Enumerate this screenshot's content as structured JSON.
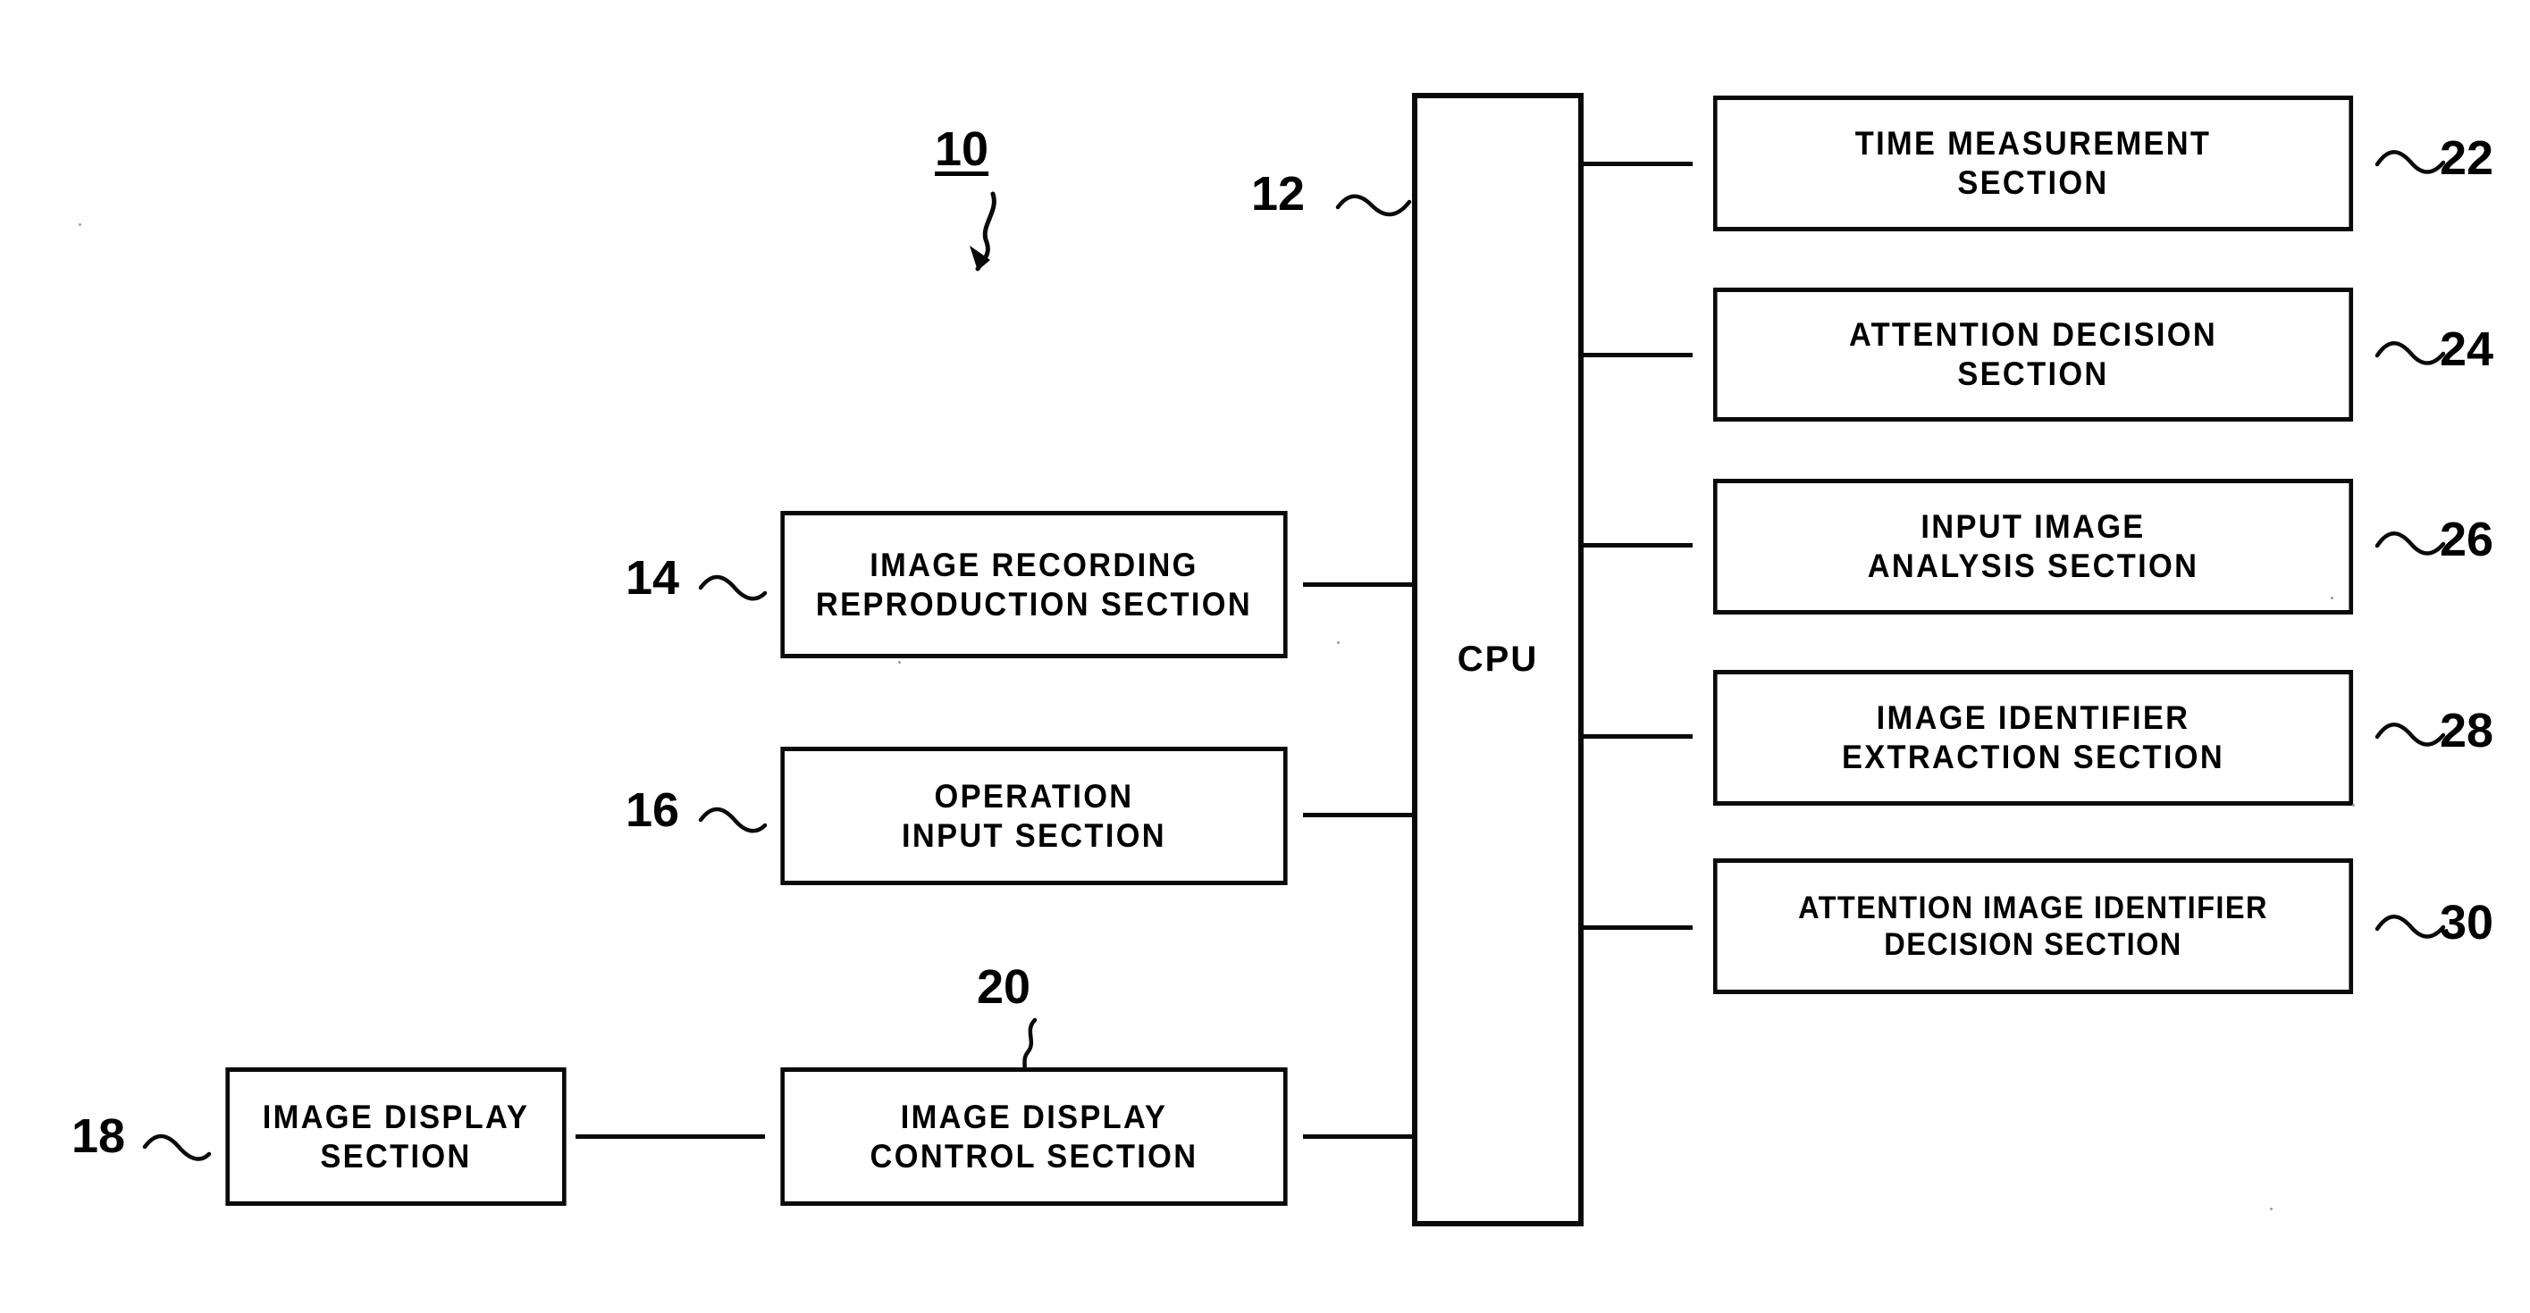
{
  "figure": {
    "system_label": "10",
    "cpu_label": "CPU",
    "cpu_ref": "12"
  },
  "left_blocks": [
    {
      "ref": "14",
      "lines": [
        "IMAGE RECORDING",
        "REPRODUCTION SECTION"
      ]
    },
    {
      "ref": "16",
      "lines": [
        "OPERATION",
        "INPUT SECTION"
      ]
    },
    {
      "ref": "18",
      "lines": [
        "IMAGE DISPLAY",
        "SECTION"
      ]
    },
    {
      "ref": "20",
      "lines": [
        "IMAGE DISPLAY",
        "CONTROL SECTION"
      ]
    }
  ],
  "right_blocks": [
    {
      "ref": "22",
      "lines": [
        "TIME MEASUREMENT",
        "SECTION"
      ]
    },
    {
      "ref": "24",
      "lines": [
        "ATTENTION DECISION",
        "SECTION"
      ]
    },
    {
      "ref": "26",
      "lines": [
        "INPUT IMAGE",
        "ANALYSIS SECTION"
      ]
    },
    {
      "ref": "28",
      "lines": [
        "IMAGE IDENTIFIER",
        "EXTRACTION SECTION"
      ]
    },
    {
      "ref": "30",
      "lines": [
        "ATTENTION IMAGE IDENTIFIER",
        "DECISION SECTION"
      ]
    }
  ],
  "colors": {
    "ink": "#0a0a0a",
    "paper": "#ffffff"
  }
}
